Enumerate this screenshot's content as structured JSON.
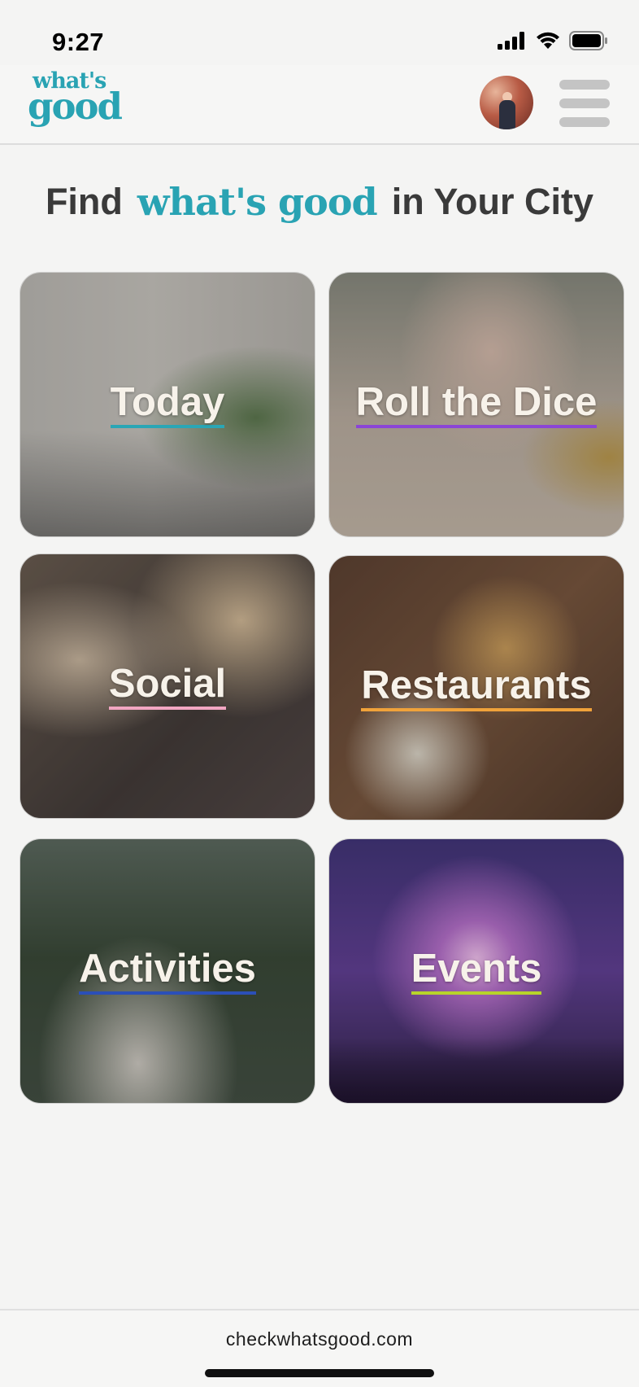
{
  "status_bar": {
    "time": "9:27",
    "icons": [
      "signal-icon",
      "wifi-icon",
      "battery-icon"
    ]
  },
  "header": {
    "logo_top": "what's",
    "logo_bottom": "good",
    "avatar_icon": "user-avatar",
    "menu_icon": "hamburger-menu-icon"
  },
  "headline": {
    "prefix": "Find",
    "brand": "what's good",
    "suffix": "in Your City"
  },
  "tiles": [
    {
      "label": "Today",
      "underline": "#2aa6b5"
    },
    {
      "label": "Roll the Dice",
      "underline": "#8b45d6"
    },
    {
      "label": "Social",
      "underline": "#f2a6c2"
    },
    {
      "label": "Restaurants",
      "underline": "#f0a23a"
    },
    {
      "label": "Activities",
      "underline": "#2b4fb8"
    },
    {
      "label": "Events",
      "underline": "#b8d42a"
    }
  ],
  "footer": {
    "url": "checkwhatsgood.com"
  },
  "colors": {
    "brand_teal": "#29a3b3",
    "heading_text": "#3a3a3a",
    "background": "#f4f4f3"
  }
}
